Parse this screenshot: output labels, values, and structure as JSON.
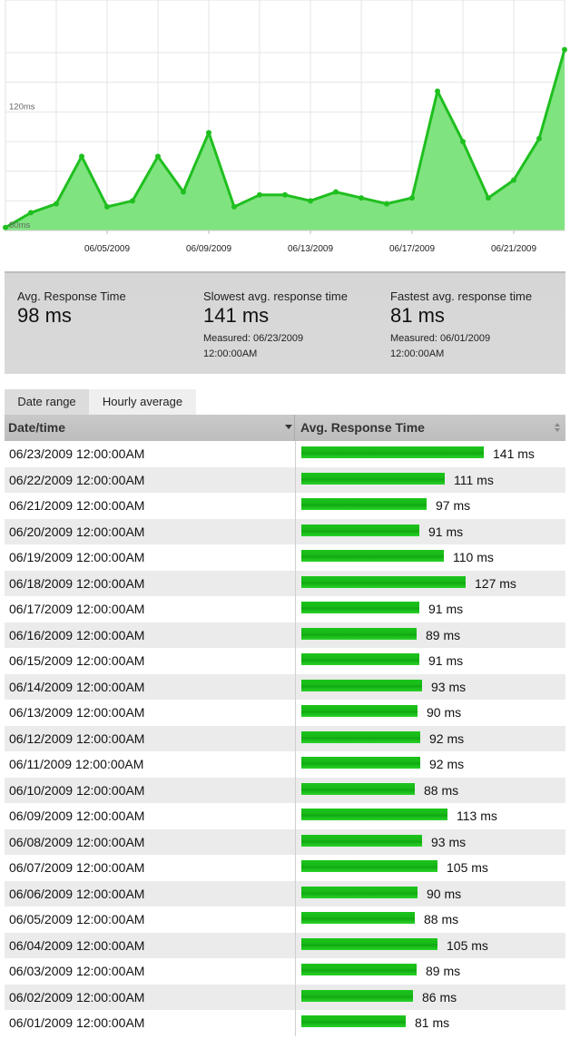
{
  "chart_data": {
    "type": "area",
    "x": [
      "06/01/2009",
      "06/02/2009",
      "06/03/2009",
      "06/04/2009",
      "06/05/2009",
      "06/06/2009",
      "06/07/2009",
      "06/08/2009",
      "06/09/2009",
      "06/10/2009",
      "06/11/2009",
      "06/12/2009",
      "06/13/2009",
      "06/14/2009",
      "06/15/2009",
      "06/16/2009",
      "06/17/2009",
      "06/18/2009",
      "06/19/2009",
      "06/20/2009",
      "06/21/2009",
      "06/22/2009",
      "06/23/2009"
    ],
    "series": [
      {
        "values": [
          81,
          86,
          89,
          105,
          88,
          90,
          105,
          93,
          113,
          88,
          92,
          92,
          90,
          93,
          91,
          89,
          91,
          127,
          110,
          91,
          97,
          111,
          141
        ]
      }
    ],
    "x_tick_labels": [
      "06/05/2009",
      "06/09/2009",
      "06/13/2009",
      "06/17/2009",
      "06/21/2009"
    ],
    "y_tick_labels": [
      {
        "value": 120,
        "label": "120ms"
      },
      {
        "value": 80,
        "label": "80ms"
      }
    ],
    "ylim": [
      80,
      140
    ],
    "grid": true,
    "color": "#1fbf1f",
    "fill": "#7fe37f"
  },
  "stats": {
    "avg": {
      "label": "Avg. Response Time",
      "value": "98 ms"
    },
    "slowest": {
      "label": "Slowest avg. response time",
      "value": "141 ms",
      "measured_prefix": "Measured: 06/23/2009",
      "measured_time": "12:00:00AM"
    },
    "fastest": {
      "label": "Fastest avg. response time",
      "value": "81 ms",
      "measured_prefix": "Measured: 06/01/2009",
      "measured_time": "12:00:00AM"
    }
  },
  "tabs": {
    "date_range": "Date range",
    "hourly_average": "Hourly average"
  },
  "table": {
    "headers": {
      "date": "Date/time",
      "response": "Avg. Response Time"
    },
    "max_value": 141,
    "rows": [
      {
        "date": "06/23/2009 12:00:00AM",
        "value": 141,
        "label": "141 ms"
      },
      {
        "date": "06/22/2009 12:00:00AM",
        "value": 111,
        "label": "111 ms"
      },
      {
        "date": "06/21/2009 12:00:00AM",
        "value": 97,
        "label": "97 ms"
      },
      {
        "date": "06/20/2009 12:00:00AM",
        "value": 91,
        "label": "91 ms"
      },
      {
        "date": "06/19/2009 12:00:00AM",
        "value": 110,
        "label": "110 ms"
      },
      {
        "date": "06/18/2009 12:00:00AM",
        "value": 127,
        "label": "127 ms"
      },
      {
        "date": "06/17/2009 12:00:00AM",
        "value": 91,
        "label": "91 ms"
      },
      {
        "date": "06/16/2009 12:00:00AM",
        "value": 89,
        "label": "89 ms"
      },
      {
        "date": "06/15/2009 12:00:00AM",
        "value": 91,
        "label": "91 ms"
      },
      {
        "date": "06/14/2009 12:00:00AM",
        "value": 93,
        "label": "93 ms"
      },
      {
        "date": "06/13/2009 12:00:00AM",
        "value": 90,
        "label": "90 ms"
      },
      {
        "date": "06/12/2009 12:00:00AM",
        "value": 92,
        "label": "92 ms"
      },
      {
        "date": "06/11/2009 12:00:00AM",
        "value": 92,
        "label": "92 ms"
      },
      {
        "date": "06/10/2009 12:00:00AM",
        "value": 88,
        "label": "88 ms"
      },
      {
        "date": "06/09/2009 12:00:00AM",
        "value": 113,
        "label": "113 ms"
      },
      {
        "date": "06/08/2009 12:00:00AM",
        "value": 93,
        "label": "93 ms"
      },
      {
        "date": "06/07/2009 12:00:00AM",
        "value": 105,
        "label": "105 ms"
      },
      {
        "date": "06/06/2009 12:00:00AM",
        "value": 90,
        "label": "90 ms"
      },
      {
        "date": "06/05/2009 12:00:00AM",
        "value": 88,
        "label": "88 ms"
      },
      {
        "date": "06/04/2009 12:00:00AM",
        "value": 105,
        "label": "105 ms"
      },
      {
        "date": "06/03/2009 12:00:00AM",
        "value": 89,
        "label": "89 ms"
      },
      {
        "date": "06/02/2009 12:00:00AM",
        "value": 86,
        "label": "86 ms"
      },
      {
        "date": "06/01/2009 12:00:00AM",
        "value": 81,
        "label": "81 ms"
      }
    ]
  }
}
